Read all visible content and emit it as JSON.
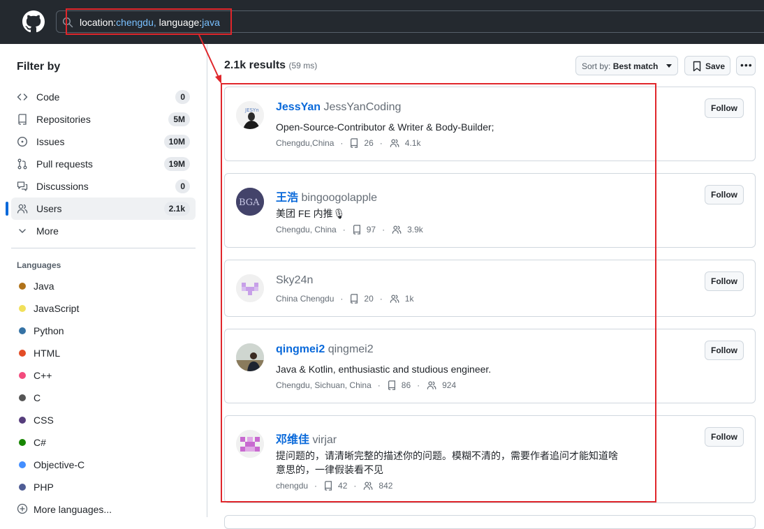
{
  "header": {
    "search_query_prefix1": "location:",
    "search_query_value1": "chengdu,",
    "search_query_prefix2": " language:",
    "search_query_value2": "java"
  },
  "sidebar": {
    "title": "Filter by",
    "items": [
      {
        "label": "Code",
        "count": "0",
        "icon": "code-icon"
      },
      {
        "label": "Repositories",
        "count": "5M",
        "icon": "repo-icon"
      },
      {
        "label": "Issues",
        "count": "10M",
        "icon": "issue-icon"
      },
      {
        "label": "Pull requests",
        "count": "19M",
        "icon": "pull-request-icon"
      },
      {
        "label": "Discussions",
        "count": "0",
        "icon": "discussion-icon"
      },
      {
        "label": "Users",
        "count": "2.1k",
        "icon": "people-icon",
        "active": true
      },
      {
        "label": "More",
        "icon": "chevron-down-icon"
      }
    ],
    "languages_title": "Languages",
    "languages": [
      {
        "name": "Java",
        "color": "#b07219"
      },
      {
        "name": "JavaScript",
        "color": "#f1e05a"
      },
      {
        "name": "Python",
        "color": "#3572A5"
      },
      {
        "name": "HTML",
        "color": "#e34c26"
      },
      {
        "name": "C++",
        "color": "#f34b7d"
      },
      {
        "name": "C",
        "color": "#555555"
      },
      {
        "name": "CSS",
        "color": "#563d7c"
      },
      {
        "name": "C#",
        "color": "#178600"
      },
      {
        "name": "Objective-C",
        "color": "#438eff"
      },
      {
        "name": "PHP",
        "color": "#4F5D95"
      }
    ],
    "more_languages": "More languages..."
  },
  "main": {
    "results_count": "2.1k results",
    "results_time": "(59 ms)",
    "sort_label": "Sort by:",
    "sort_value": "Best match",
    "save_label": "Save",
    "follow_label": "Follow",
    "users": [
      {
        "display_name": "JessYan",
        "login": "JessYanCoding",
        "bio": "Open-Source-Contributor & Writer & Body-Builder;",
        "location": "Chengdu,China",
        "repos": "26",
        "followers": "4.1k"
      },
      {
        "display_name": "王浩",
        "login": "bingoogolapple",
        "bio": "美团 FE 内推🎙",
        "location": "Chengdu, China",
        "repos": "97",
        "followers": "3.9k"
      },
      {
        "display_name": "",
        "login": "Sky24n",
        "bio": "",
        "location": "China Chengdu",
        "repos": "20",
        "followers": "1k"
      },
      {
        "display_name": "qingmei2",
        "login": "qingmei2",
        "bio": "Java & Kotlin, enthusiastic and studious engineer.",
        "location": "Chengdu, Sichuan, China",
        "repos": "86",
        "followers": "924"
      },
      {
        "display_name": "邓维佳",
        "login": "virjar",
        "bio": "提问题的，请清晰完整的描述你的问题。模糊不清的，需要作者追问才能知道啥意思的，一律假装看不见",
        "location": "chengdu",
        "repos": "42",
        "followers": "842"
      }
    ]
  },
  "colors": {
    "accent": "#0969da",
    "annotation": "#e0262b",
    "header_bg": "#24292f"
  }
}
